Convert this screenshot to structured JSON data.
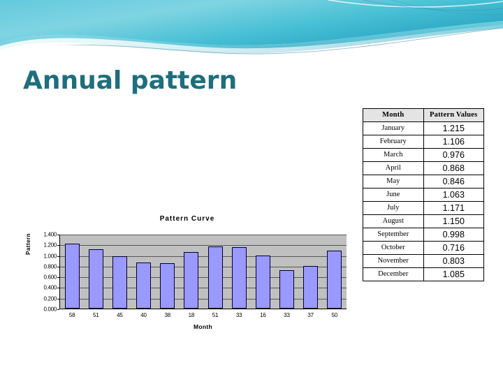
{
  "slide": {
    "title": "Annual pattern",
    "title_color": "#1F6E7D",
    "background_color": "#FFFFFF",
    "theme_accent_color": "#4EC3D9"
  },
  "table": {
    "headers": [
      "Month",
      "Pattern Values"
    ],
    "header_bg": "#E4E4E4",
    "rows": [
      {
        "month": "January",
        "value": "1.215"
      },
      {
        "month": "February",
        "value": "1.106"
      },
      {
        "month": "March",
        "value": "0.976"
      },
      {
        "month": "April",
        "value": "0.868"
      },
      {
        "month": "May",
        "value": "0.846"
      },
      {
        "month": "June",
        "value": "1.063"
      },
      {
        "month": "July",
        "value": "1.171"
      },
      {
        "month": "August",
        "value": "1.150"
      },
      {
        "month": "September",
        "value": "0.998"
      },
      {
        "month": "October",
        "value": "0.716"
      },
      {
        "month": "November",
        "value": "0.803"
      },
      {
        "month": "December",
        "value": "1.085"
      }
    ]
  },
  "chart_data": {
    "type": "bar",
    "title": "Pattern  Curve",
    "xlabel": "Month",
    "ylabel": "Pattern",
    "categories": [
      "58",
      "51",
      "45",
      "40",
      "38",
      "18",
      "51",
      "33",
      "16",
      "33",
      "37",
      "50"
    ],
    "values": [
      1.215,
      1.106,
      0.976,
      0.868,
      0.846,
      1.063,
      1.171,
      1.15,
      0.998,
      0.716,
      0.803,
      1.085
    ],
    "series": [
      {
        "name": "Pattern",
        "values": [
          1.215,
          1.106,
          0.976,
          0.868,
          0.846,
          1.063,
          1.171,
          1.15,
          0.998,
          0.716,
          0.803,
          1.085
        ]
      }
    ],
    "ylim": [
      0.0,
      1.4
    ],
    "ytick_labels": [
      "1.400",
      "1.200",
      "1.000",
      "0.800",
      "0.600",
      "0.400",
      "0.200",
      "0.000"
    ],
    "ytick_values": [
      1.4,
      1.2,
      1.0,
      0.8,
      0.6,
      0.4,
      0.2,
      0.0
    ],
    "grid": true,
    "legend": "none",
    "bar_color": "#9999FF",
    "bar_border_color": "#000033",
    "plot_background": "#C0C0C0"
  }
}
